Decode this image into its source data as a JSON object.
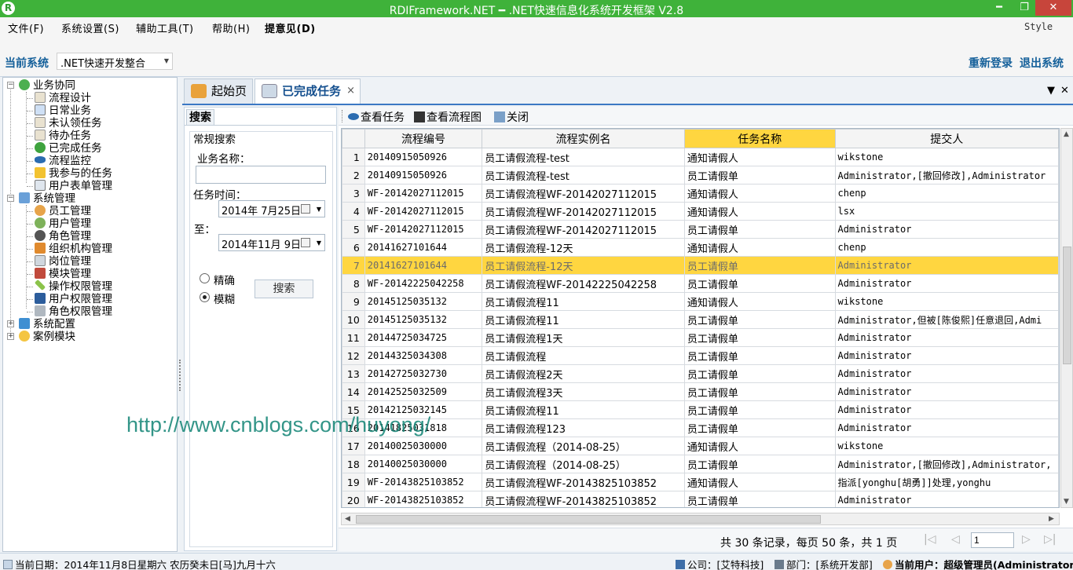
{
  "window": {
    "title": "RDIFramework.NET ━ .NET快速信息化系统开发框架 V2.8",
    "logo": "R",
    "minimize": "━",
    "maximize": "❐",
    "close": "✕"
  },
  "menu": {
    "file": "文件(F)",
    "settings": "系统设置(S)",
    "tools": "辅助工具(T)",
    "help": "帮助(H)",
    "feedback": "提意见(D)",
    "style": "Style"
  },
  "system": {
    "label": "当前系统",
    "selected": ".NET快速开发整合",
    "relogin": "重新登录",
    "logout": "退出系统"
  },
  "tree": {
    "groups": [
      {
        "label": "业务协同",
        "children": [
          "流程设计",
          "日常业务",
          "未认领任务",
          "待办任务",
          "已完成任务",
          "流程监控",
          "我参与的任务",
          "用户表单管理"
        ]
      },
      {
        "label": "系统管理",
        "children": [
          "员工管理",
          "用户管理",
          "角色管理",
          "组织机构管理",
          "岗位管理",
          "模块管理",
          "操作权限管理",
          "用户权限管理",
          "角色权限管理"
        ]
      },
      {
        "label": "系统配置",
        "children": []
      },
      {
        "label": "案例模块",
        "children": []
      }
    ]
  },
  "tabs": {
    "home": "起始页",
    "active": "已完成任务",
    "close": "×",
    "menu": "▼",
    "close_all": "✕"
  },
  "search": {
    "tab": "搜索",
    "group": "常规搜索",
    "name_label": "业务名称：",
    "name_value": "",
    "time_label": "任务时间：",
    "from": "2014年 7月25日",
    "to_label": "至：",
    "to": "2014年11月 9日",
    "exact": "精确",
    "fuzzy": "模糊",
    "fuzzy_selected": true,
    "button": "搜索"
  },
  "toolbar": {
    "view_task": "查看任务",
    "view_flow": "查看流程图",
    "close": "关闭"
  },
  "grid": {
    "columns": [
      "流程编号",
      "流程实例名",
      "任务名称",
      "提交人"
    ],
    "selected_column": 2,
    "selected_row": 6,
    "rows": [
      [
        "1",
        "20140915050926",
        "员工请假流程-test",
        "通知请假人",
        "wikstone"
      ],
      [
        "2",
        "20140915050926",
        "员工请假流程-test",
        "员工请假单",
        "Administrator,[撤回修改],Administrator"
      ],
      [
        "3",
        "WF-20142027112015",
        "员工请假流程WF-20142027112015",
        "通知请假人",
        "chenp"
      ],
      [
        "4",
        "WF-20142027112015",
        "员工请假流程WF-20142027112015",
        "通知请假人",
        "lsx"
      ],
      [
        "5",
        "WF-20142027112015",
        "员工请假流程WF-20142027112015",
        "员工请假单",
        "Administrator"
      ],
      [
        "6",
        "20141627101644",
        "员工请假流程-12天",
        "通知请假人",
        "chenp"
      ],
      [
        "7",
        "20141627101644",
        "员工请假流程-12天",
        "员工请假单",
        "Administrator"
      ],
      [
        "8",
        "WF-20142225042258",
        "员工请假流程WF-20142225042258",
        "员工请假单",
        "Administrator"
      ],
      [
        "9",
        "20145125035132",
        "员工请假流程11",
        "通知请假人",
        "wikstone"
      ],
      [
        "10",
        "20145125035132",
        "员工请假流程11",
        "员工请假单",
        "Administrator,但被[陈俊熙]任意退回,Admi"
      ],
      [
        "11",
        "20144725034725",
        "员工请假流程1天",
        "员工请假单",
        "Administrator"
      ],
      [
        "12",
        "20144325034308",
        "员工请假流程",
        "员工请假单",
        "Administrator"
      ],
      [
        "13",
        "20142725032730",
        "员工请假流程2天",
        "员工请假单",
        "Administrator"
      ],
      [
        "14",
        "20142525032509",
        "员工请假流程3天",
        "员工请假单",
        "Administrator"
      ],
      [
        "15",
        "20142125032145",
        "员工请假流程11",
        "员工请假单",
        "Administrator"
      ],
      [
        "16",
        "20141825031818",
        "员工请假流程123",
        "员工请假单",
        "Administrator"
      ],
      [
        "17",
        "20140025030000",
        "员工请假流程（2014-08-25）",
        "通知请假人",
        "wikstone"
      ],
      [
        "18",
        "20140025030000",
        "员工请假流程（2014-08-25）",
        "员工请假单",
        "Administrator,[撤回修改],Administrator,"
      ],
      [
        "19",
        "WF-20143825103852",
        "员工请假流程WF-20143825103852",
        "通知请假人",
        "指派[yonghu[胡勇]]处理,yonghu"
      ],
      [
        "20",
        "WF-20143825103852",
        "员工请假流程WF-20143825103852",
        "员工请假单",
        "Administrator"
      ]
    ]
  },
  "pager": {
    "summary": "共 30 条记录，每页 50 条，共 1 页",
    "first": "|◁",
    "prev": "◁",
    "page": "1",
    "next": "▷",
    "last": "▷|"
  },
  "watermark": "http://www.cnblogs.com/huyong/",
  "status": {
    "date": "当前日期：2014年11月8日星期六 农历癸未日[马]九月十六",
    "company": "公司：[艾特科技]",
    "dept": "部门：[系统开发部]",
    "user": "当前用户：超级管理员(Administrator)"
  }
}
